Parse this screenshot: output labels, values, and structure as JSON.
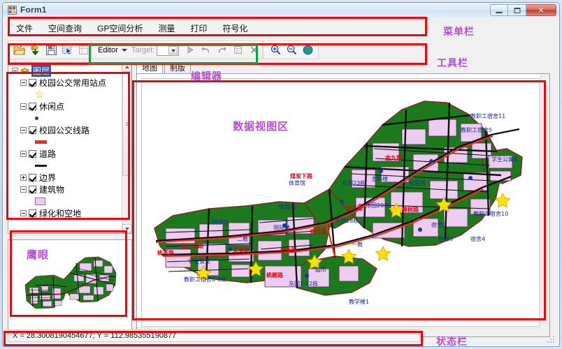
{
  "window": {
    "title": "Form1",
    "icon": "form-icon",
    "buttons": {
      "minimize": "minimize-icon",
      "maximize": "maximize-icon",
      "close": "close-icon"
    }
  },
  "menubar": {
    "items": [
      {
        "label": "文件"
      },
      {
        "label": "空间查询"
      },
      {
        "label": "GP空间分析"
      },
      {
        "label": "测量"
      },
      {
        "label": "打印"
      },
      {
        "label": "符号化"
      }
    ]
  },
  "toolbar": {
    "file_group": [
      {
        "name": "open-folder-icon",
        "title": "打开"
      },
      {
        "name": "add-data-icon",
        "title": "添加数据"
      },
      {
        "name": "save-icon",
        "title": "保存"
      },
      {
        "name": "select-features-icon",
        "title": "选择要素"
      },
      {
        "name": "attribute-table-icon",
        "title": "属性表"
      },
      {
        "name": "pan-hand-icon",
        "title": "漫游"
      }
    ],
    "editor_group": {
      "menu_label": "Editor",
      "target_label": "Target:",
      "target_value": "",
      "target_placeholder": "",
      "buttons": [
        {
          "name": "sketch-tool-icon",
          "title": "编辑工具"
        },
        {
          "name": "undo-icon",
          "title": "撤销"
        },
        {
          "name": "redo-icon",
          "title": "重做"
        },
        {
          "name": "editor-attributes-icon",
          "title": "属性"
        },
        {
          "name": "delete-icon",
          "title": "删除"
        }
      ]
    },
    "zoom_group": [
      {
        "name": "zoom-in-icon",
        "title": "放大"
      },
      {
        "name": "zoom-out-icon",
        "title": "缩小"
      },
      {
        "name": "full-extent-globe-icon",
        "title": "全图"
      }
    ]
  },
  "toc": {
    "root": {
      "label": "图层",
      "expander": "minus",
      "checked": true
    },
    "layers": [
      {
        "label": "校园公交常用站点",
        "expander": "minus",
        "checked": true,
        "symbol": "star",
        "symbol_color": "#ffe100"
      },
      {
        "label": "休闲点",
        "expander": "minus",
        "checked": true,
        "symbol": "dot",
        "symbol_color": "#17389c"
      },
      {
        "label": "校园公交线路",
        "expander": "minus",
        "checked": true,
        "symbol": "redline",
        "symbol_color": "#ec2b21"
      },
      {
        "label": "道路",
        "expander": "minus",
        "checked": true,
        "symbol": "blackline",
        "symbol_color": "#1a1a1a"
      },
      {
        "label": "边界",
        "expander": "plus",
        "checked": true,
        "symbol": "none"
      },
      {
        "label": "建筑物",
        "expander": "minus",
        "checked": true,
        "symbol": "polygon",
        "symbol_color": "#eccdf0"
      },
      {
        "label": "绿化和空地",
        "expander": "minus",
        "checked": true,
        "symbol": "none"
      }
    ]
  },
  "tabs": [
    {
      "label": "地图",
      "active": true
    },
    {
      "label": "制版",
      "active": false
    }
  ],
  "statusbar": {
    "coordinates": "X = 28.3008190454677;  Y = 112.985355190877"
  },
  "annotations": {
    "menubar": "菜单栏",
    "toolbar": "工具栏",
    "editor": "编辑器",
    "data_view": "数据视图区",
    "eagle_eye": "鹰眼",
    "statusbar": "状态栏"
  },
  "map": {
    "background": "#ffffff",
    "green_fill": "#1b7a1b",
    "building_fill": "#eccdf0",
    "road_color": "#1a1a1a",
    "bus_line_color": "#ec2b21",
    "station_color": "#ffe100",
    "label_color_blue": "#16299c",
    "label_color_red": "#e3000f",
    "labels": [
      "教职工宿舍11",
      "教职工宿舍10",
      "教职工宿舍5",
      "学生公寓6",
      "东园23栋",
      "东园20栋",
      "东园18栋",
      "东园1-12栋",
      "安石山路",
      "煤炭下路",
      "金九路",
      "文奥路",
      "杉木路",
      "体育馆",
      "体育场",
      "主科楼",
      "国际楼",
      "一教",
      "二教",
      "教学楼1",
      "图书馆",
      "学生食堂",
      "校医院",
      "超市"
    ]
  },
  "colors": {
    "annotation_red": "#fb0007",
    "annotation_green": "#00aa3c",
    "annotation_label": "#b54fd1",
    "toc_selected": "#2a5db0"
  }
}
